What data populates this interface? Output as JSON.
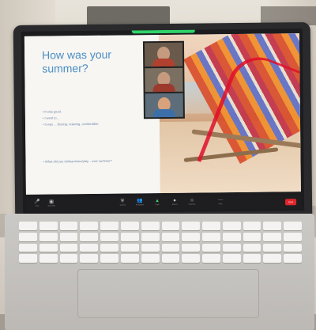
{
  "slide": {
    "title": "How was your summer?",
    "bullets": [
      "It was good.",
      "I went to...",
      "It was ... (boring, relaxing, comfortable,"
    ],
    "question": "What did you do/learn/see/play... over summer?"
  },
  "toolbar": {
    "buttons": [
      {
        "icon": "mic-icon",
        "glyph": "🎤",
        "label": "Mute"
      },
      {
        "icon": "camera-icon",
        "glyph": "▣",
        "label": "Stop Video"
      },
      {
        "icon": "security-icon",
        "glyph": "⛨",
        "label": "Security"
      },
      {
        "icon": "participants-icon",
        "glyph": "👥",
        "label": "Participants"
      },
      {
        "icon": "share-icon",
        "glyph": "▲",
        "label": "Share"
      },
      {
        "icon": "record-icon",
        "glyph": "●",
        "label": "Record"
      },
      {
        "icon": "reactions-icon",
        "glyph": "☺",
        "label": "Reactions"
      },
      {
        "icon": "more-icon",
        "glyph": "⋯",
        "label": "More"
      }
    ],
    "end_label": "End"
  },
  "colors": {
    "title_blue": "#4b8ec4",
    "end_red": "#e0262d",
    "active_green": "#3fd46f"
  }
}
